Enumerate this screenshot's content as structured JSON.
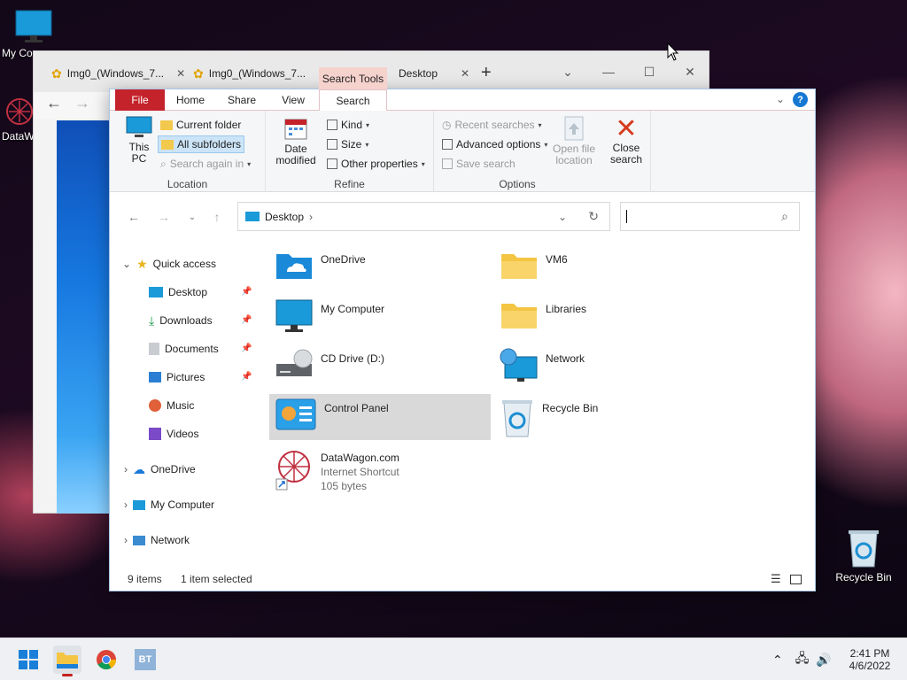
{
  "desktop": {
    "icons": [
      {
        "label": "My Co"
      },
      {
        "label": "DataW"
      },
      {
        "label": "Recycle Bin"
      }
    ]
  },
  "browser": {
    "tabs": [
      {
        "label": "Img0_(Windows_7..."
      },
      {
        "label": "Img0_(Windows_7..."
      },
      {
        "label": "Desktop"
      }
    ],
    "new_tab": "+"
  },
  "explorer": {
    "context_tab": "Search Tools",
    "tabs": [
      "File",
      "Home",
      "Share",
      "View",
      "Search"
    ],
    "active_tab": "Search",
    "ribbon": {
      "location": {
        "label": "Location",
        "this_pc": "This PC",
        "current_folder": "Current folder",
        "all_subfolders": "All subfolders",
        "search_again_in": "Search again in"
      },
      "refine": {
        "label": "Refine",
        "date_modified": "Date modified",
        "kind": "Kind",
        "size": "Size",
        "other_properties": "Other properties"
      },
      "options": {
        "label": "Options",
        "recent_searches": "Recent searches",
        "advanced_options": "Advanced options",
        "save_search": "Save search",
        "open_file_location": "Open file location",
        "close_search": "Close search"
      }
    },
    "address": {
      "path": "Desktop"
    },
    "search": {
      "value": ""
    },
    "sidebar": {
      "quick_access": "Quick access",
      "items": [
        {
          "label": "Desktop"
        },
        {
          "label": "Downloads"
        },
        {
          "label": "Documents"
        },
        {
          "label": "Pictures"
        },
        {
          "label": "Music"
        },
        {
          "label": "Videos"
        }
      ],
      "onedrive": "OneDrive",
      "my_computer": "My Computer",
      "network": "Network"
    },
    "files": [
      {
        "name": "OneDrive"
      },
      {
        "name": "VM6"
      },
      {
        "name": "My Computer"
      },
      {
        "name": "Libraries"
      },
      {
        "name": "CD Drive (D:)"
      },
      {
        "name": "Network"
      },
      {
        "name": "Control Panel"
      },
      {
        "name": "Recycle Bin"
      },
      {
        "name": "DataWagon.com",
        "type": "Internet Shortcut",
        "size": "105 bytes"
      }
    ],
    "status": {
      "count": "9 items",
      "selected": "1 item selected"
    }
  },
  "taskbar": {
    "time": "2:41 PM",
    "date": "4/6/2022"
  }
}
